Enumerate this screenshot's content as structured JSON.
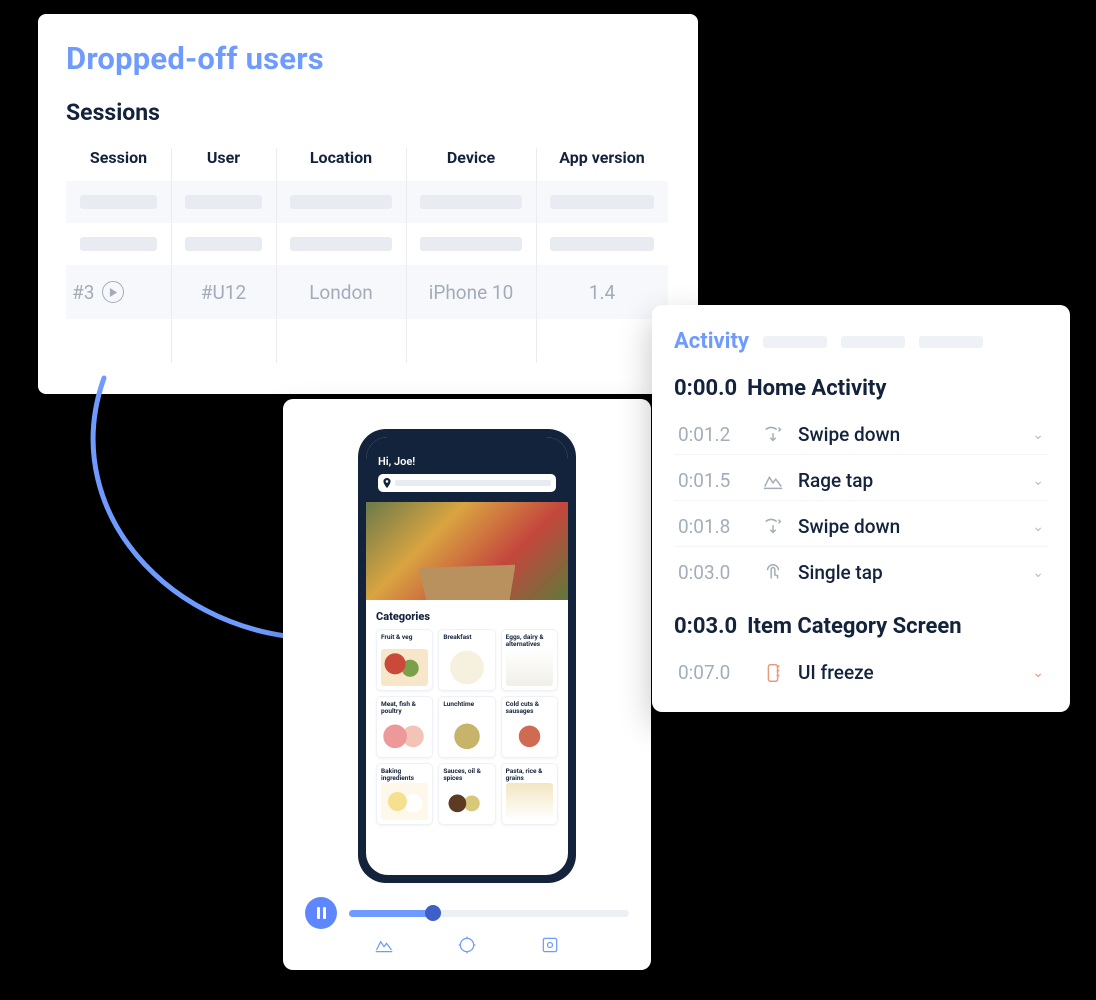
{
  "sessions": {
    "title": "Dropped-off users",
    "subtitle": "Sessions",
    "columns": [
      "Session",
      "User",
      "Location",
      "Device",
      "App version"
    ],
    "row": {
      "session": "#3",
      "user": "#U12",
      "location": "London",
      "device": "iPhone 10",
      "version": "1.4"
    }
  },
  "phone": {
    "greeting": "Hi, Joe!",
    "categories_title": "Categories",
    "categories": [
      "Fruit & veg",
      "Breakfast",
      "Eggs, dairy & alternatives",
      "Meat, fish & poultry",
      "Lunchtime",
      "Cold cuts & sausages",
      "Baking ingredients",
      "Sauces, oil & spices",
      "Pasta, rice & grains"
    ]
  },
  "activity": {
    "title": "Activity",
    "screens": [
      {
        "time": "0:00.0",
        "name": "Home Activity"
      },
      {
        "time": "0:03.0",
        "name": "Item Category Screen"
      }
    ],
    "events": [
      {
        "time": "0:01.2",
        "type": "swipe-down",
        "label": "Swipe down"
      },
      {
        "time": "0:01.5",
        "type": "rage-tap",
        "label": "Rage tap"
      },
      {
        "time": "0:01.8",
        "type": "swipe-down",
        "label": "Swipe down"
      },
      {
        "time": "0:03.0",
        "type": "single-tap",
        "label": "Single tap"
      }
    ],
    "events2": [
      {
        "time": "0:07.0",
        "type": "ui-freeze",
        "label": "UI freeze"
      }
    ]
  }
}
